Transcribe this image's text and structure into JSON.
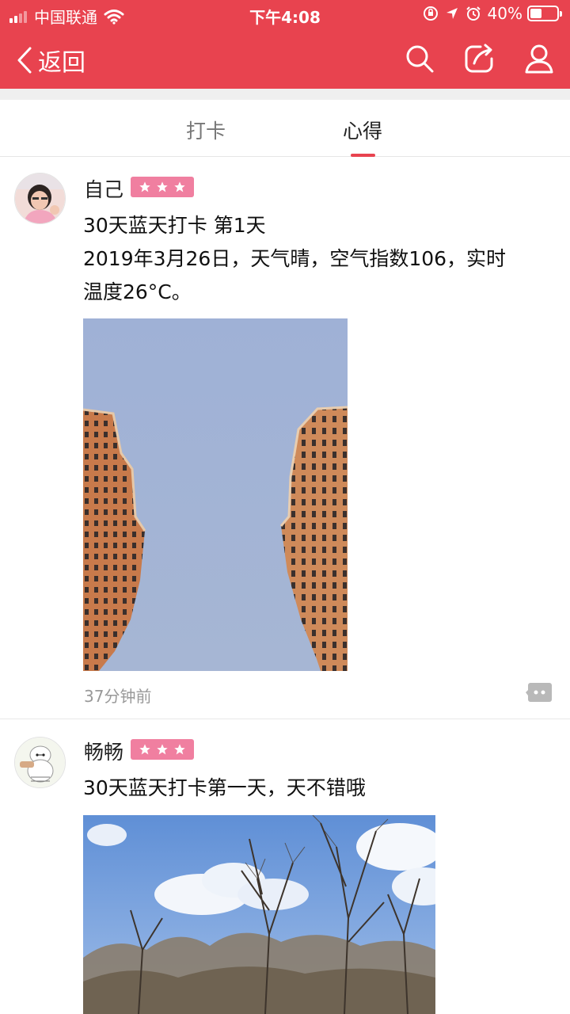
{
  "status_bar": {
    "carrier": "中国联通",
    "time": "下午4:08",
    "battery": "40%"
  },
  "nav": {
    "back_label": "返回",
    "icons": [
      "search-icon",
      "share-icon",
      "user-icon"
    ]
  },
  "tabs": [
    {
      "label": "打卡",
      "active": false
    },
    {
      "label": "心得",
      "active": true
    }
  ],
  "posts": [
    {
      "username": "自己",
      "stars": 3,
      "text_lines": [
        "30天蓝天打卡 第1天",
        "2019年3月26日，天气晴，空气指数106，实时",
        "温度26°C。"
      ],
      "time": "37分钟前"
    },
    {
      "username": "畅畅",
      "stars": 3,
      "text_lines": [
        "30天蓝天打卡第一天，天不错哦"
      ]
    }
  ],
  "colors": {
    "brand": "#e8434f",
    "badge": "#f07fa0"
  }
}
